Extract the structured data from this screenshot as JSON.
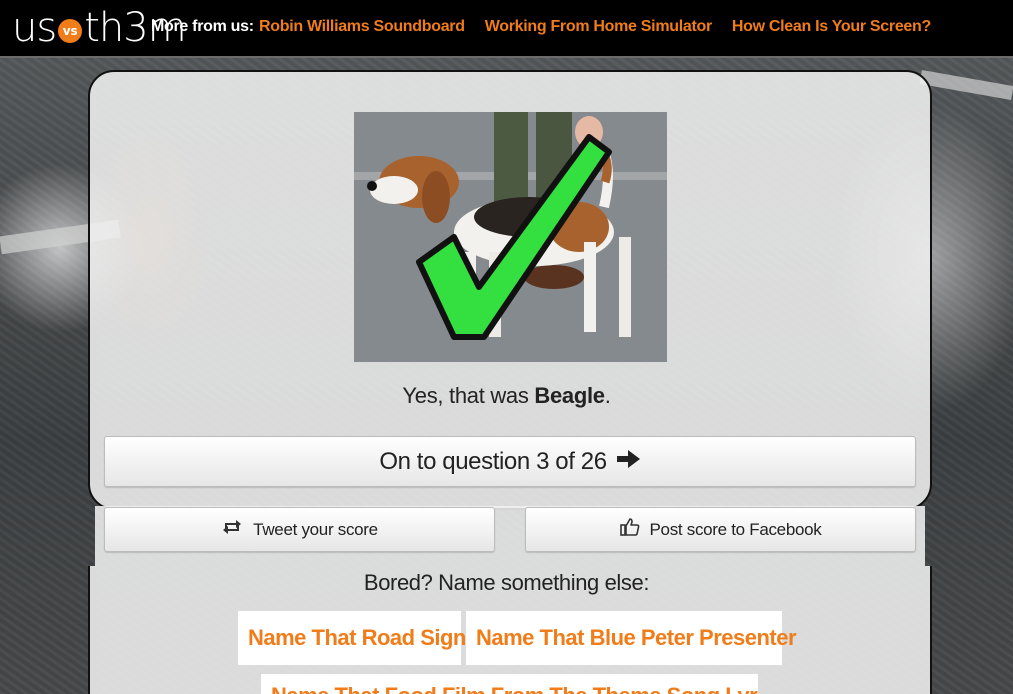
{
  "header": {
    "logo_text_left": "us",
    "logo_vs": "vs",
    "logo_text_right": "th3m",
    "more_label": "More from us:",
    "links": [
      "Robin Williams Soundboard",
      "Working From Home Simulator",
      "How Clean Is Your Screen?"
    ]
  },
  "quiz": {
    "answer_prefix": "Yes, that was ",
    "answer_name": "Beagle",
    "answer_suffix": ".",
    "next_label": "On to question 3 of 26",
    "current_question": 3,
    "total_questions": 26,
    "result_icon": "check-mark-icon"
  },
  "share": {
    "tweet_label": "Tweet your score",
    "tweet_icon": "retweet-icon",
    "facebook_label": "Post score to Facebook",
    "facebook_icon": "thumbs-up-icon"
  },
  "more_games": {
    "heading": "Bored? Name something else:",
    "items": [
      "Name That Road Sign",
      "Name That Blue Peter Presenter",
      "Name That Food Film From The Theme Song Lyrics"
    ]
  },
  "colors": {
    "accent": "#f07c1a",
    "check": "#33e03f",
    "header_bg": "#000000"
  }
}
